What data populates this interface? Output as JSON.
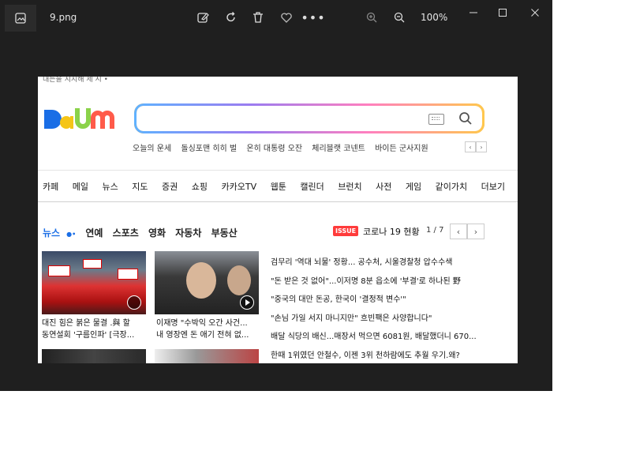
{
  "viewer": {
    "file_name": "9.png",
    "zoom": "100%",
    "icons": [
      "image-icon",
      "edit-icon",
      "rotate-icon",
      "delete-icon",
      "favorite-icon",
      "more-icon",
      "zoom-in-icon",
      "zoom-out-icon",
      "minimize-icon",
      "maximize-icon",
      "close-icon"
    ]
  },
  "daum": {
    "top_snippet": "내는을 지지해 세 시 •",
    "logo": "Daum",
    "search_placeholder": "",
    "trends": [
      "오늘의 운세",
      "돌싱포맨 히히 벌",
      "온히 대통령 오잔",
      "체리블랫 코넨트",
      "바이든 군사지원"
    ],
    "gnb": [
      "카페",
      "메일",
      "뉴스",
      "지도",
      "증권",
      "쇼핑",
      "카카오TV",
      "웹툰",
      "캘린더",
      "브런치",
      "사전",
      "게임",
      "같이가치",
      "더보기"
    ],
    "tabs": [
      "뉴스",
      "연예",
      "스포츠",
      "영화",
      "자동차",
      "부동산"
    ],
    "issue_badge": "ISSUE",
    "issue_text": "코로나 19 현황",
    "issue_count": "1 / 7",
    "pager_prev": "‹",
    "pager_next": "›",
    "thumb1_caption": [
      "대진 힘은 붉은 물결 .與 할",
      "동연설회 '구름인파' [극장..."
    ],
    "thumb2_caption": [
      "이재명 \"수박익 오간 사건...",
      "내 영장엔 돈 애기 전혀 없..."
    ],
    "headlines": [
      "검무리 '역대 뇌물' 정황... 공수처, 시울경찰청 압수수색",
      "\"돈 받은 것 없어\"...이저명 8분 읍소에 '부결'로 하나된 野",
      "\"중국의 대만 돈공, 한국이 '결정적 변수'\"",
      "\"손님 가일 서지 마니지만\" 흐빈팩은 사양합니다\"",
      "배달 식당의 배신...매장서 먹으면 6081원, 배달했더니 670...",
      "한때 1위였던 안철수, 이젠 3위 천하람에도 추월 우기.왜?"
    ],
    "colors": {
      "accent_blue": "#1a6ee6",
      "issue_red": "#ff3b3b",
      "search_border": "#f0a93b"
    }
  }
}
